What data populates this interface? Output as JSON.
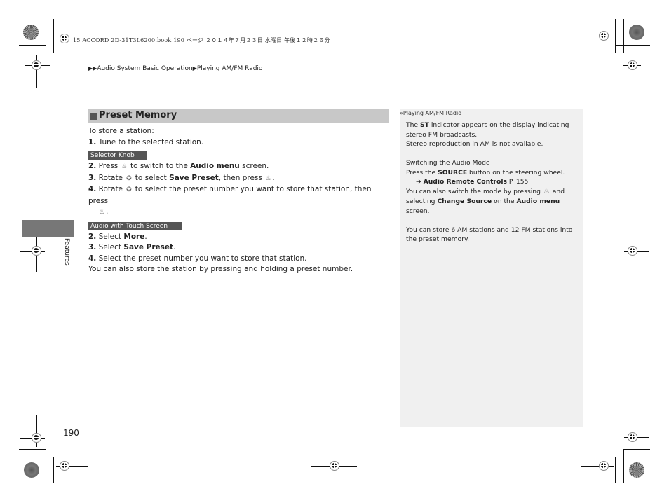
{
  "header_meta": "15 ACCORD 2D-31T3L6200.book  190 ページ  ２０１４年７月２３日  水曜日  午後１２時２６分",
  "breadcrumb": {
    "prefix": "▶▶",
    "items": [
      "Audio System Basic Operation",
      "Playing AM/FM Radio"
    ],
    "separator": "▶"
  },
  "section": {
    "title": "Preset Memory",
    "intro": "To store a station:",
    "step1": {
      "num": "1.",
      "text": "Tune to the selected station."
    },
    "selector_knob": {
      "tag": "Selector Knob",
      "steps": [
        {
          "num": "2.",
          "pre": "Press",
          "icon": "press-knob-icon",
          "mid": "to switch to the",
          "bold": "Audio menu",
          "post": "screen."
        },
        {
          "num": "3.",
          "pre": "Rotate",
          "icon": "rotate-knob-icon",
          "mid": "to select",
          "bold": "Save Preset",
          "post": ", then press",
          "post_icon": "press-knob-icon",
          "end": "."
        },
        {
          "num": "4.",
          "pre": "Rotate",
          "icon": "rotate-knob-icon",
          "mid": "to select the preset number you want to store that station, then press",
          "post_icon": "press-knob-icon",
          "end": "."
        }
      ]
    },
    "touch_screen": {
      "tag": "Audio with Touch Screen",
      "steps": [
        {
          "num": "2.",
          "pre": "Select",
          "bold": "More",
          "post": "."
        },
        {
          "num": "3.",
          "pre": "Select",
          "bold": "Save Preset",
          "post": "."
        },
        {
          "num": "4.",
          "pre": "Select the preset number you want to store that station."
        }
      ],
      "note": "You can also store the station by pressing and holding a preset number."
    }
  },
  "sidebar": {
    "head_icon": "»",
    "head": "Playing AM/FM Radio",
    "p1_pre": "The",
    "p1_bold": "ST",
    "p1_post": "indicator appears on the display indicating stereo FM broadcasts.",
    "p2": "Stereo reproduction in AM is not available.",
    "p3_title": "Switching the Audio Mode",
    "p3_pre": "Press the",
    "p3_bold": "SOURCE",
    "p3_post": "button on the steering wheel.",
    "ref_icon": "➔",
    "ref_bold": "Audio Remote Controls",
    "ref_page": "P. 155",
    "p4_pre": "You can also switch the mode by pressing",
    "p4_mid": "and selecting",
    "p4_bold1": "Change Source",
    "p4_mid2": "on the",
    "p4_bold2": "Audio menu",
    "p4_post": "screen.",
    "p5": "You can store 6 AM stations and 12 FM stations into the preset memory."
  },
  "side_tab": "Features",
  "page_number": "190"
}
